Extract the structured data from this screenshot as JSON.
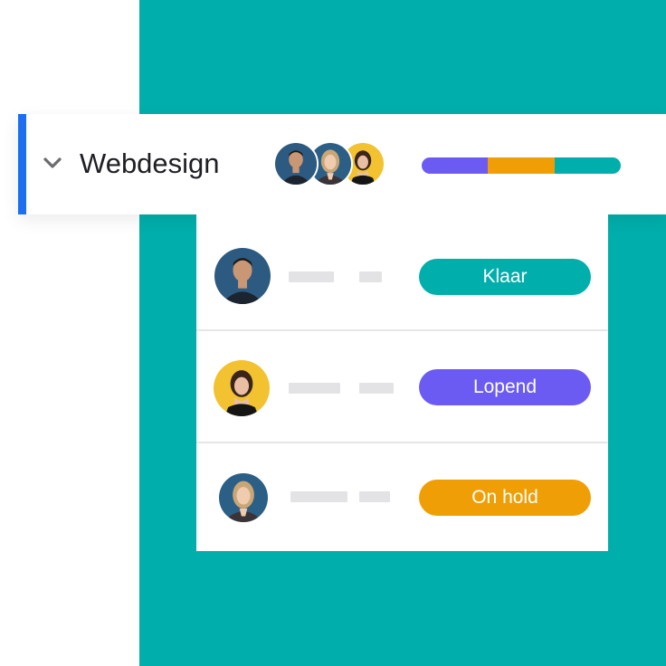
{
  "colors": {
    "background_teal": "#00aeab",
    "accent_blue": "#1d6ff2",
    "purple": "#6c5bf3",
    "orange": "#f09e05",
    "teal": "#00aeab"
  },
  "group": {
    "title": "Webdesign",
    "expand_icon": "chevron-down-icon",
    "members": [
      "man-avatar",
      "blonde-woman-avatar",
      "brunette-woman-avatar"
    ],
    "progress": [
      {
        "status": "Lopend",
        "fraction": 0.33,
        "color": "#6c5bf3"
      },
      {
        "status": "On hold",
        "fraction": 0.34,
        "color": "#f09e05"
      },
      {
        "status": "Klaar",
        "fraction": 0.33,
        "color": "#00aeab"
      }
    ]
  },
  "tasks": [
    {
      "assignee": "man-avatar",
      "status": "Klaar",
      "status_color": "#00aeab"
    },
    {
      "assignee": "brunette-woman-avatar",
      "status": "Lopend",
      "status_color": "#6c5bf3"
    },
    {
      "assignee": "blonde-woman-avatar",
      "status": "On hold",
      "status_color": "#f09e05"
    }
  ]
}
